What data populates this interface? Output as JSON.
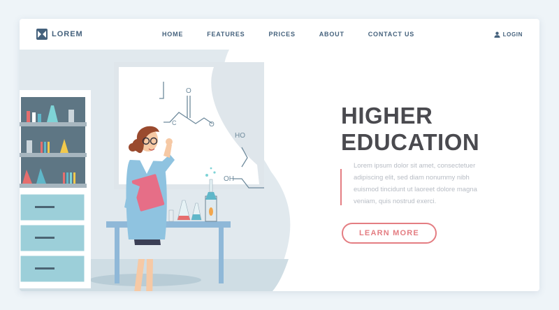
{
  "brand": {
    "name": "LOREM",
    "logo_icon": "bowtie-logo-icon"
  },
  "nav": {
    "items": [
      {
        "label": "HOME"
      },
      {
        "label": "FEATURES"
      },
      {
        "label": "PRICES"
      },
      {
        "label": "ABOUT"
      },
      {
        "label": "CONTACT US"
      }
    ],
    "login": {
      "label": "LOGIN",
      "icon": "user-icon"
    }
  },
  "hero": {
    "title_line1": "HIGHER",
    "title_line2": "EDUCATION",
    "description": "Lorem ipsum dolor sit amet, consectetuer adipiscing elit, sed diam nonummy nibh euismod tincidunt ut laoreet dolore magna veniam, quis nostrud exerci.",
    "cta_label": "LEARN MORE"
  },
  "illustration": {
    "board_text": {
      "c": "C",
      "o": "O",
      "ho": "HO",
      "oh": "OH"
    }
  },
  "colors": {
    "primary": "#44617c",
    "accent": "#e47d82",
    "heading": "#4a4a4f",
    "muted_text": "#b7bcc4",
    "background": "#eef4f8"
  }
}
